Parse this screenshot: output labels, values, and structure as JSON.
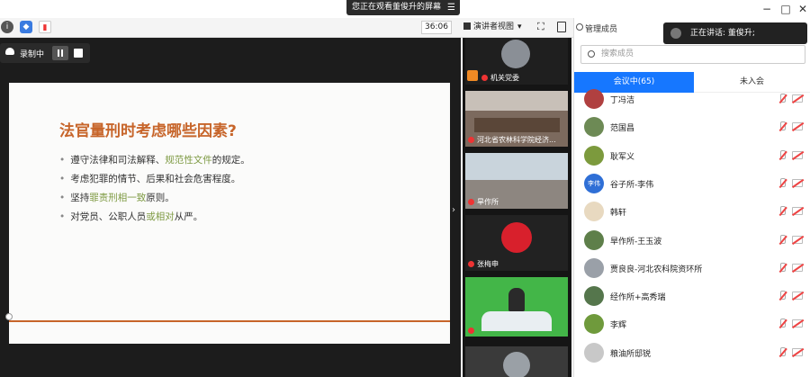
{
  "window": {
    "screen_share_banner": "您正在观看董俊升的屏幕",
    "controls": {
      "minimize": "−",
      "maximize": "□",
      "close": "✕"
    }
  },
  "toolbar": {
    "timer": "36:06",
    "view_mode": "演讲者视图",
    "icons": [
      "info-icon",
      "shield-icon",
      "signal-icon",
      "fullscreen-icon",
      "panel-toggle-icon"
    ]
  },
  "recording": {
    "label": "录制中"
  },
  "slide": {
    "title": "法官量刑时考虑哪些因素?",
    "bullets": [
      {
        "parts": [
          "遵守法律和司法解释、",
          "规范性文件",
          "的规定。"
        ]
      },
      {
        "parts": [
          "考虑犯罪的情节、后果和社会危害程度。",
          "",
          ""
        ]
      },
      {
        "parts": [
          "坚持",
          "罪责刑相一致",
          "原则。"
        ]
      },
      {
        "parts": [
          "对党员、公职人员",
          "或",
          "相对",
          "从严。"
        ]
      }
    ]
  },
  "video_tiles": [
    {
      "name": "机关党委"
    },
    {
      "name": "河北省农林科学院经济..."
    },
    {
      "name": "旱作所"
    },
    {
      "name": "张梅申"
    },
    {
      "name": ""
    }
  ],
  "panel": {
    "title": "管理成员",
    "speaking": "正在讲话: 董俊升;",
    "search_placeholder": "搜索成员",
    "tabs": {
      "in_meeting": "会议中(65)",
      "not_joined": "未入会"
    },
    "members": [
      {
        "name": "丁冯洁",
        "avatar": "#b04040"
      },
      {
        "name": "范国昌",
        "avatar": "#6d8a55"
      },
      {
        "name": "耿军义",
        "avatar": "#7c9a3d"
      },
      {
        "name": "谷子所-李伟",
        "avatar": "#2f6fd6",
        "initials": "李伟"
      },
      {
        "name": "韩轩",
        "avatar": "#e8d9c0"
      },
      {
        "name": "旱作所-王玉波",
        "avatar": "#5e7f4a"
      },
      {
        "name": "贾良良-河北农科院资环所",
        "avatar": "#9aa0a8"
      },
      {
        "name": "经作所+高秀瑞",
        "avatar": "#55764c"
      },
      {
        "name": "李辉",
        "avatar": "#6f9a3c"
      },
      {
        "name": "粮油所邸锐",
        "avatar": "#c8c8c8"
      }
    ]
  }
}
